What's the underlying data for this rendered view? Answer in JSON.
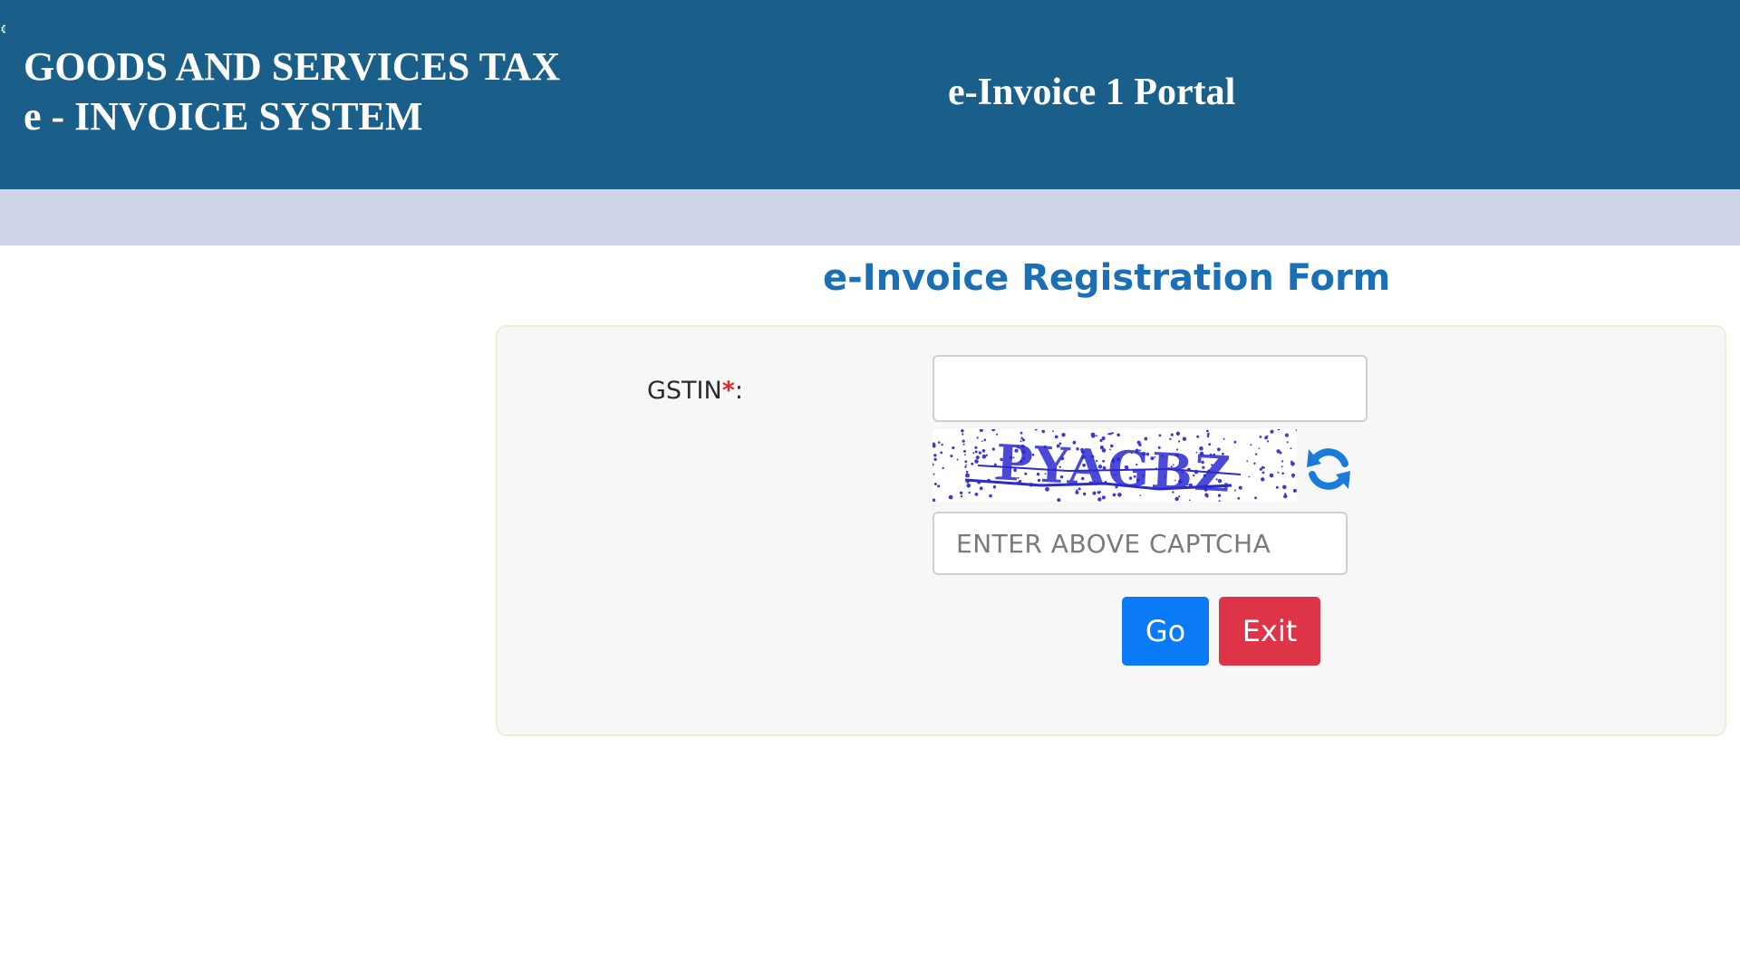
{
  "header": {
    "title_line1": "GOODS AND SERVICES TAX",
    "title_line2": "e - INVOICE SYSTEM",
    "portal_name": "e-Invoice 1 Portal"
  },
  "form": {
    "title": "e-Invoice Registration Form",
    "gstin_label": "GSTIN",
    "required_mark": "*",
    "label_suffix": ":",
    "gstin_value": "",
    "captcha_text": "PYAGBZ",
    "captcha_placeholder": "ENTER ABOVE CAPTCHA",
    "go_label": "Go",
    "exit_label": "Exit"
  },
  "icons": {
    "refresh": "refresh-icon"
  },
  "colors": {
    "header_bg": "#195f8a",
    "subbar_bg": "#cfd4e8",
    "title_blue": "#1a6fb5",
    "go_blue": "#0b7af7",
    "exit_red": "#de3447",
    "required_red": "#e0262b",
    "captcha_ink": "#2a2acf"
  }
}
